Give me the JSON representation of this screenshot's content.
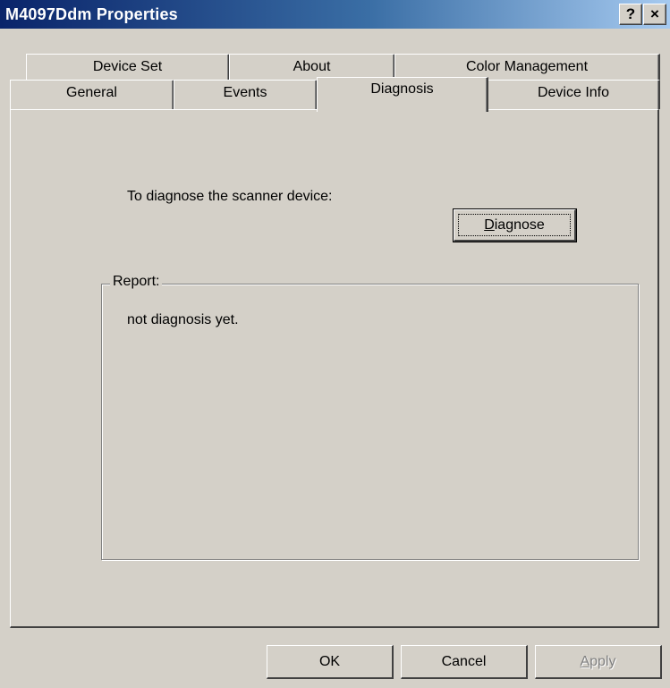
{
  "window": {
    "title": "M4097Ddm Properties",
    "help_label": "?",
    "close_label": "×"
  },
  "tabs": {
    "row1": [
      {
        "label": "Device Set"
      },
      {
        "label": "About"
      },
      {
        "label": "Color Management"
      }
    ],
    "row2": [
      {
        "label": "General"
      },
      {
        "label": "Events"
      },
      {
        "label": "Diagnosis",
        "active": true
      },
      {
        "label": "Device Info"
      }
    ]
  },
  "diagnosis": {
    "prompt": "To diagnose the scanner device:",
    "button_underlined": "D",
    "button_rest": "iagnose"
  },
  "report": {
    "label": "Report:",
    "text": "not diagnosis yet."
  },
  "footer": {
    "ok": "OK",
    "cancel": "Cancel",
    "apply_underlined": "A",
    "apply_rest": "pply"
  }
}
